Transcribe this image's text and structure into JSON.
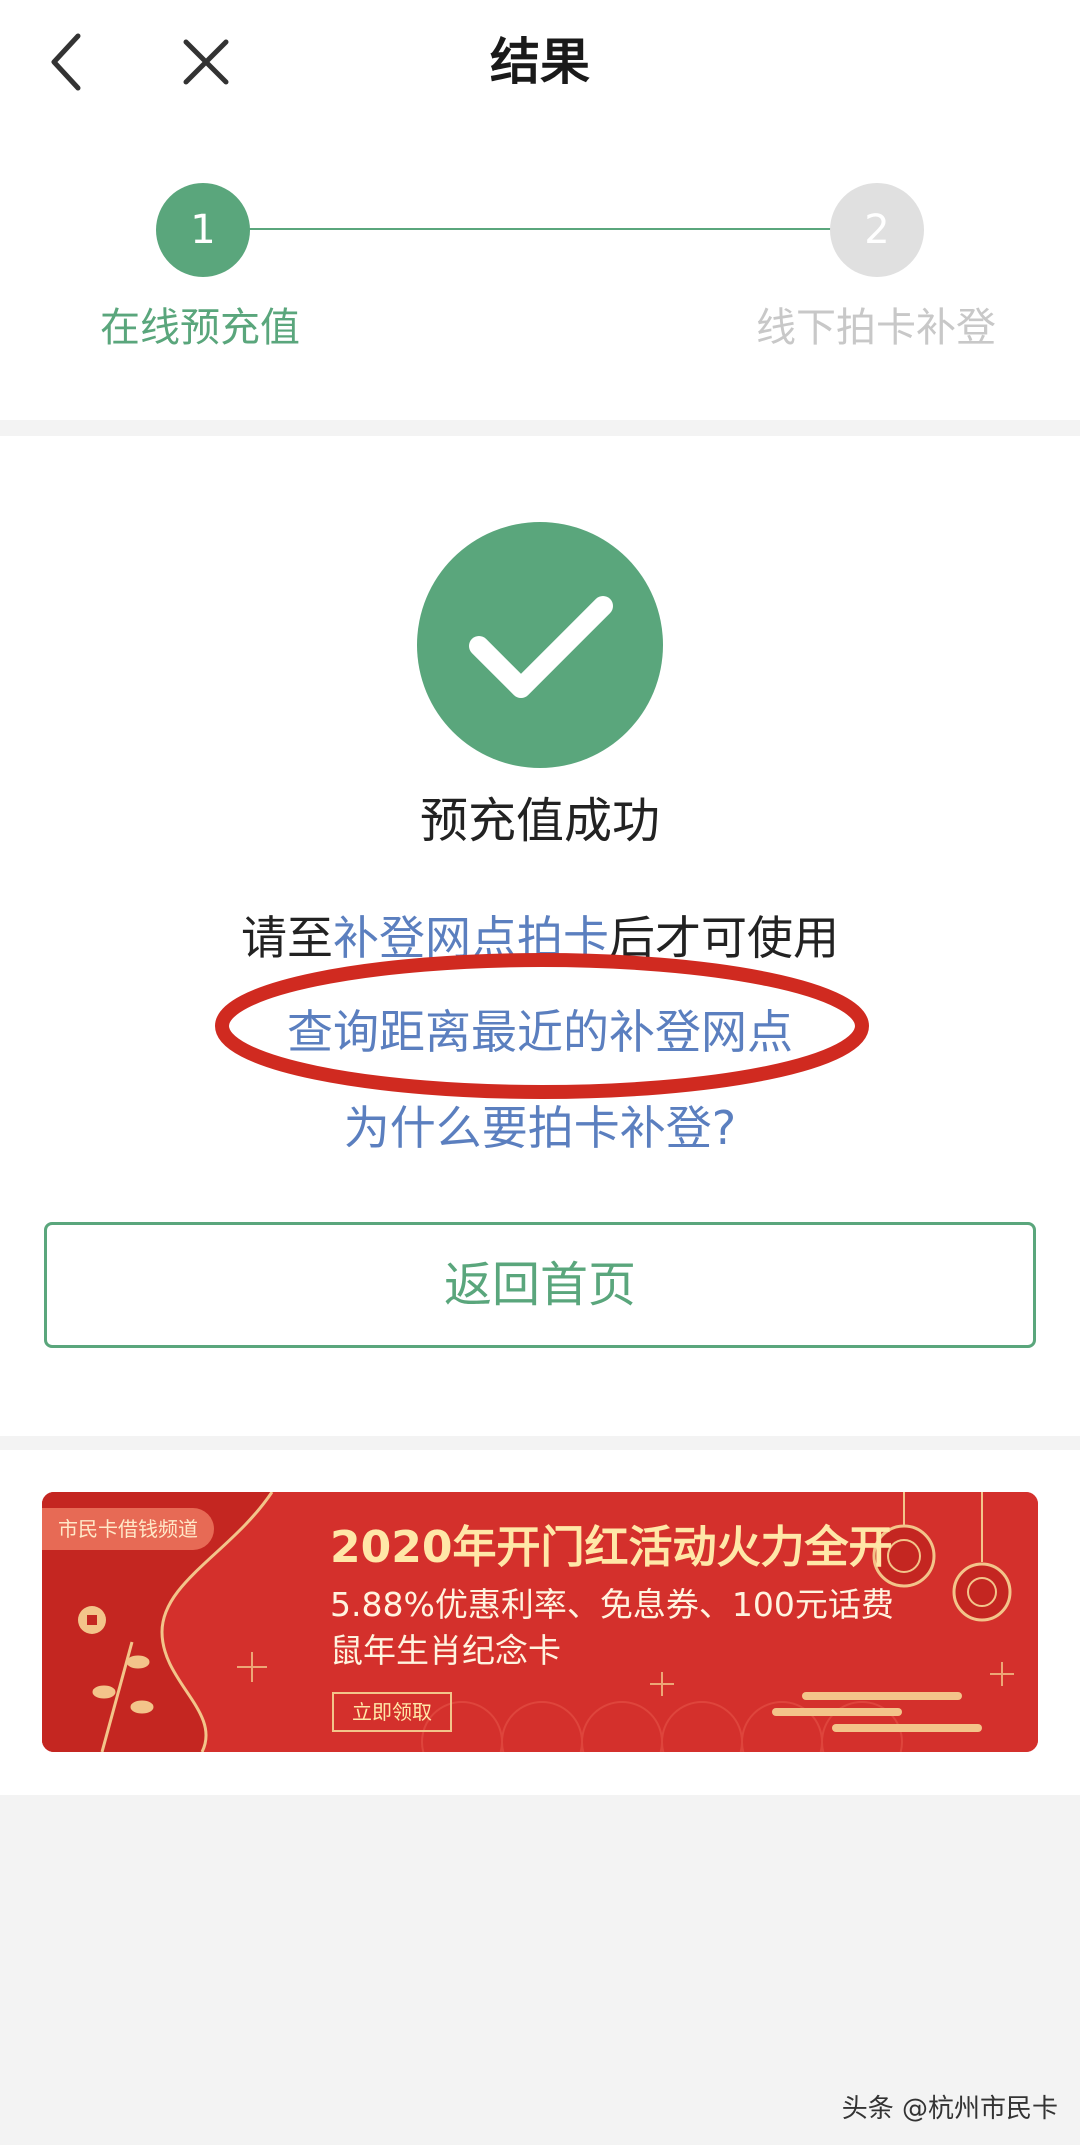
{
  "nav": {
    "title": "结果",
    "back_icon": "chevron-left-icon",
    "close_icon": "close-icon"
  },
  "steps": [
    {
      "number": "1",
      "label": "在线预充值",
      "state": "active"
    },
    {
      "number": "2",
      "label": "线下拍卡补登",
      "state": "inactive"
    }
  ],
  "result": {
    "icon": "check-circle-icon",
    "title": "预充值成功",
    "hint_prefix": "请至",
    "hint_link": "补登网点拍卡",
    "hint_suffix": "后才可使用",
    "link_nearest": "查询距离最近的补登网点",
    "link_why": "为什么要拍卡补登?",
    "home_button": "返回首页"
  },
  "banner": {
    "tag": "市民卡借钱频道",
    "headline": "2020年开门红活动火力全开",
    "line1": "5.88%优惠利率、免息券、100元话费",
    "line2": "鼠年生肖纪念卡",
    "cta": "立即领取"
  },
  "watermark": "头条 @杭州市民卡",
  "colors": {
    "accent": "#5aa67c",
    "link": "#5b7fbf",
    "annotation": "#d02a20",
    "banner_bg": "#d4302c"
  }
}
